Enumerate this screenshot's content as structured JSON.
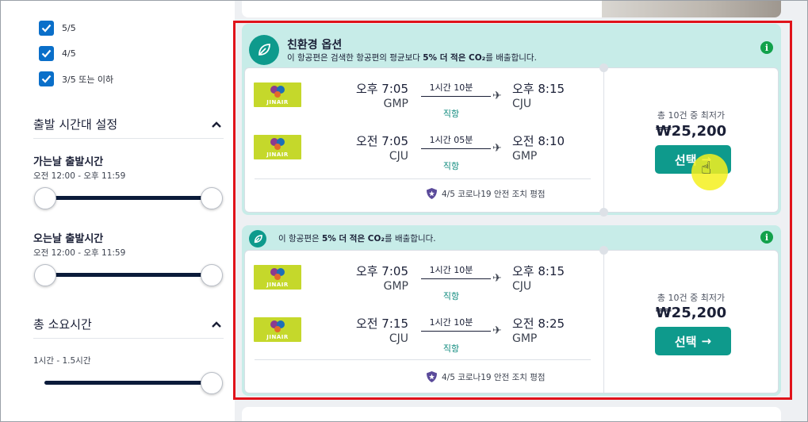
{
  "filters": {
    "rating_options": [
      {
        "label": "5/5",
        "checked": true
      },
      {
        "label": "4/5",
        "checked": true
      },
      {
        "label": "3/5 또는 이하",
        "checked": true
      }
    ],
    "departure_section": {
      "title": "출발 시간대 설정",
      "outbound_label": "가는날 출발시간",
      "outbound_range": "오전 12:00 - 오후 11:59",
      "return_label": "오는날 출발시간",
      "return_range": "오전 12:00 - 오후 11:59"
    },
    "duration_section": {
      "title": "총 소요시간",
      "range": "1시간 - 1.5시간"
    }
  },
  "offers": [
    {
      "eco_title": "친환경 옵션",
      "eco_prefix": "이 항공편은 검색한 항공편의 평균보다 ",
      "eco_bold": "5% 더 적은 CO₂",
      "eco_suffix": "를 배출합니다.",
      "legs": [
        {
          "airline": "JINAIR",
          "dep_time": "오후 7:05",
          "dep_code": "GMP",
          "duration": "1시간 10분",
          "stops": "직항",
          "arr_time": "오후 8:15",
          "arr_code": "CJU"
        },
        {
          "airline": "JINAIR",
          "dep_time": "오전 7:05",
          "dep_code": "CJU",
          "duration": "1시간 05분",
          "stops": "직항",
          "arr_time": "오전 8:10",
          "arr_code": "GMP"
        }
      ],
      "covid_rating": "4/5 코로나19 안전 조치 평점",
      "price_note": "총 10건 중 최저가",
      "price": "₩25,200",
      "select_label": "선택"
    },
    {
      "eco_prefix": "이 항공편은 ",
      "eco_bold": "5% 더 적은 CO₂",
      "eco_suffix": "를 배출합니다.",
      "legs": [
        {
          "airline": "JINAIR",
          "dep_time": "오후 7:05",
          "dep_code": "GMP",
          "duration": "1시간 10분",
          "stops": "직항",
          "arr_time": "오후 8:15",
          "arr_code": "CJU"
        },
        {
          "airline": "JINAIR",
          "dep_time": "오전 7:15",
          "dep_code": "CJU",
          "duration": "1시간 10분",
          "stops": "직항",
          "arr_time": "오전 8:25",
          "arr_code": "GMP"
        }
      ],
      "covid_rating": "4/5 코로나19 안전 조치 평점",
      "price_note": "총 10건 중 최저가",
      "price": "₩25,200",
      "select_label": "선택"
    }
  ],
  "colors": {
    "accent_teal": "#0e9a8c",
    "eco_band": "#c7ece8",
    "highlight_red": "#e0131b",
    "checkbox_blue": "#0a6fc9"
  }
}
